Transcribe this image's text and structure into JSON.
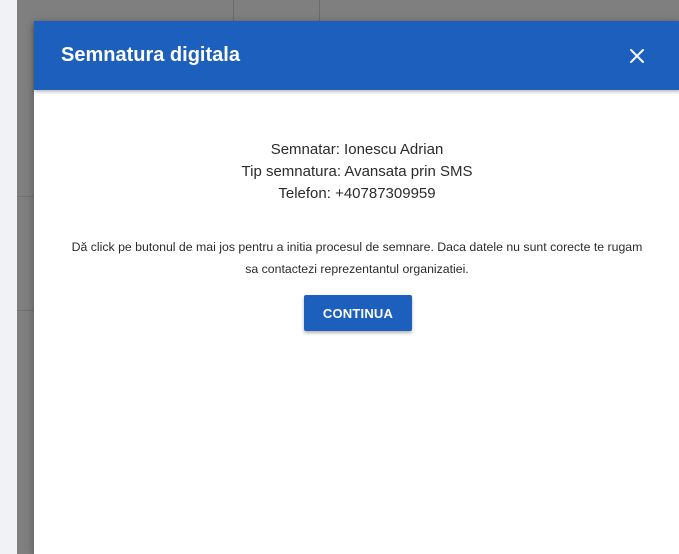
{
  "dialog": {
    "title": "Semnatura digitala",
    "close_icon": "close-icon",
    "signer": "Semnatar: Ionescu Adrian",
    "signature_type": "Tip semnatura: Avansata prin SMS",
    "phone": "Telefon: +40787309959",
    "instructions": "Dă click pe butonul de mai jos pentru a initia procesul de semnare. Daca datele nu sunt corecte te rugam sa contactezi reprezentantul organizatiei.",
    "continue_label": "CONTINUA"
  },
  "colors": {
    "header": "#1d5fbd",
    "button": "#1d5fbd",
    "backdrop": "#7f7f7f"
  }
}
